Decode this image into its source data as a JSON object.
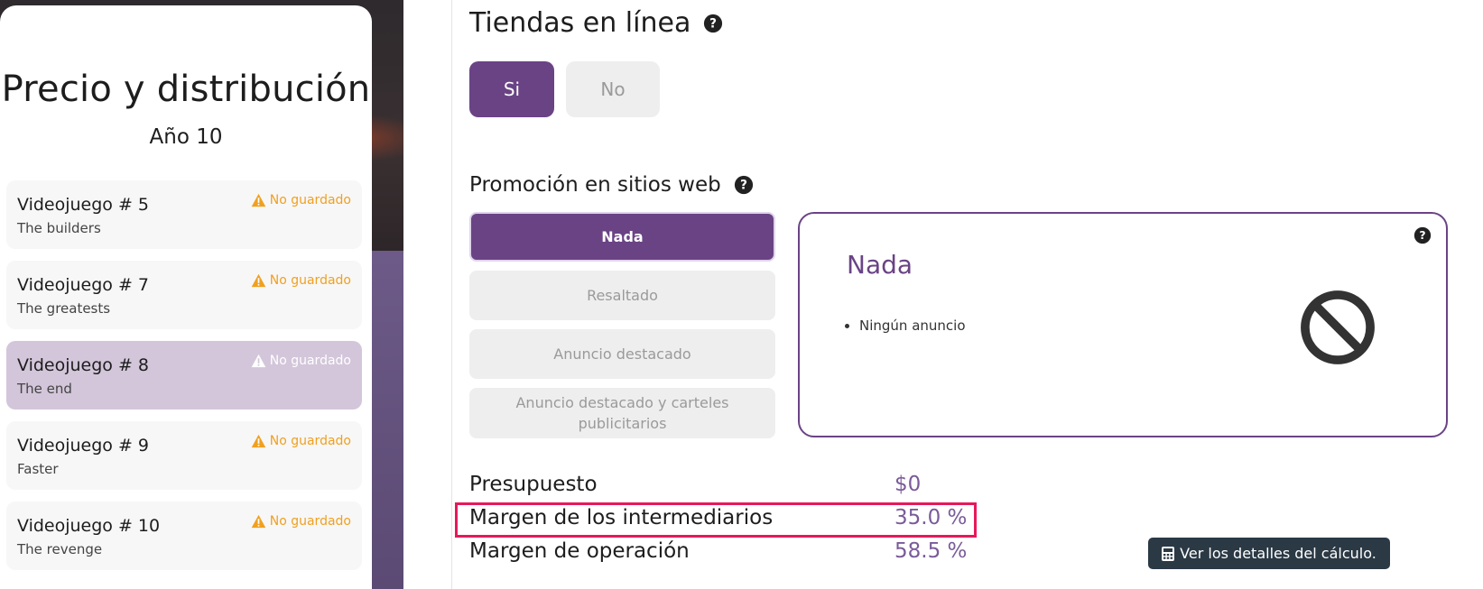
{
  "sidebar": {
    "title": "Precio y distribución",
    "subtitle": "Año 10",
    "games": [
      {
        "name": "Videojuego # 5",
        "subtitle": "The builders",
        "status": "No guardado",
        "selected": false
      },
      {
        "name": "Videojuego # 7",
        "subtitle": "The greatests",
        "status": "No guardado",
        "selected": false
      },
      {
        "name": "Videojuego # 8",
        "subtitle": "The end",
        "status": "No guardado",
        "selected": true
      },
      {
        "name": "Videojuego # 9",
        "subtitle": "Faster",
        "status": "No guardado",
        "selected": false
      },
      {
        "name": "Videojuego # 10",
        "subtitle": "The revenge",
        "status": "No guardado",
        "selected": false
      }
    ]
  },
  "online_stores": {
    "title": "Tiendas en línea",
    "yes_label": "Si",
    "no_label": "No",
    "selected": "Si"
  },
  "promotion": {
    "title": "Promoción en sitios web",
    "options": [
      {
        "label": "Nada",
        "selected": true
      },
      {
        "label": "Resaltado",
        "selected": false
      },
      {
        "label": "Anuncio destacado",
        "selected": false
      },
      {
        "label": "Anuncio destacado y carteles publicitarios",
        "selected": false
      }
    ],
    "detail": {
      "title": "Nada",
      "bullets": [
        "Ningún anuncio"
      ],
      "icon": "ban-icon"
    }
  },
  "metrics": {
    "budget_label": "Presupuesto",
    "budget_value": "$0",
    "intermediary_label": "Margen de los intermediarios",
    "intermediary_value": "35.0 %",
    "operation_label": "Margen de operación",
    "operation_value": "58.5 %"
  },
  "calc_button": {
    "label": "Ver los detalles del cálculo.",
    "icon": "calculator-icon"
  },
  "colors": {
    "accent": "#6a4385",
    "warning": "#f0a020",
    "highlight": "#e6195a",
    "dark_button": "#2b3945"
  }
}
